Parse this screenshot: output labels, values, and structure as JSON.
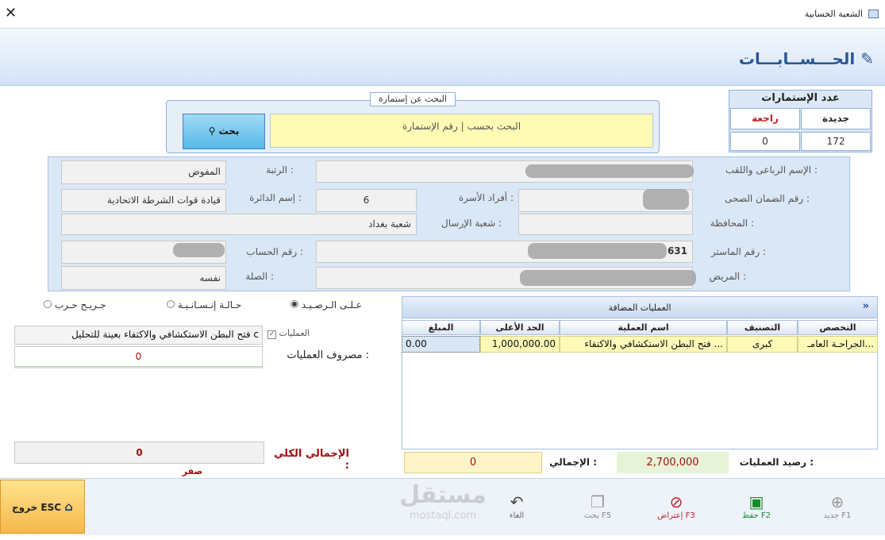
{
  "window": {
    "title": "الشعبة الحسابية",
    "close_glyph": "✕"
  },
  "header": {
    "title": "الحـــســابـــات"
  },
  "stats": {
    "title": "عدد الإستمارات",
    "new_label": "جديدة",
    "returned_label": "راجعة",
    "new_value": "172",
    "returned_value": "0"
  },
  "search": {
    "legend": "البحث عن إستمارة",
    "placeholder": "البحث بحسب | رقم الإستمارة",
    "button_label": "بحث"
  },
  "form": {
    "full_name_label": "الإسم الرباعى واللقب :",
    "rank_label": "الرتبة :",
    "rank_value": "المفوض",
    "health_id_label": "رقم الضمان الصحى :",
    "family_label": "أفراد الأسرة :",
    "family_value": "6",
    "dept_label": "إسم الدائرة :",
    "dept_value": "قيادة قوات الشرطة الاتحادية",
    "province_label": "المحافظة :",
    "sending_label": "شعبة الإرسال :",
    "sending_value": "شعبة بغداد",
    "master_label": "رقم الماستر :",
    "master_value": "631",
    "account_label": "رقم الحساب :",
    "patient_label": "المريض :",
    "relation_label": "الصلة :",
    "relation_value": "نفسه"
  },
  "radios": {
    "balance": "عـلـى الـرصـيـد",
    "humanitarian": "حـالـة إنـسـانـيـة",
    "war_wounded": "جـريـح حـرب"
  },
  "ops": {
    "checkbox_label": "العمليات",
    "selected_op": "فتح البطن الاستكشافي والاكتفاء بعينة للتحليل c",
    "cost_label": "مصروف العمليات :",
    "cost_value": "0",
    "total_label": "الإجمالي الكلي :",
    "total_value": "0",
    "total_words": "صفر"
  },
  "grid": {
    "title": "العمليات المضافة",
    "collapse_glyph": "»",
    "columns": [
      "التخصص",
      "التصنيف",
      "اسم العملية",
      "الحد الأعلى",
      "المبلغ"
    ],
    "rows": [
      {
        "specialty": "الجراحـة العامـ...",
        "category": "كبرى",
        "operation": "فتح البطن الاستكشافي والاكتفاء ...",
        "max": "1,000,000.00",
        "amount": "0.00"
      }
    ]
  },
  "balance": {
    "ops_balance_label": "رصيد العمليات :",
    "ops_balance_value": "2,700,000",
    "total_label": "الإجمالي :",
    "total_value": "0"
  },
  "toolbar": {
    "new": "جديد F1",
    "save": "حفظ F2",
    "object": "إعتراض F3",
    "search": "بحث F5",
    "cancel": "الغاء",
    "exit": "خروج ESC"
  },
  "watermark": {
    "arabic": "مستقل",
    "latin": "mostaql.com"
  },
  "colors": {
    "accent": "#2b5796",
    "search_bg": "#fffab4",
    "exit_bg": "#f6b84a",
    "red_text": "#a01010",
    "save_green": "#1a8a2a"
  }
}
